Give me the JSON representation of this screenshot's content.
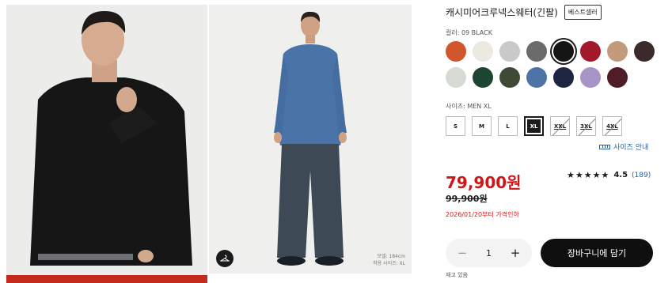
{
  "product": {
    "title": "캐시미어크루넥스웨터(긴팔)",
    "badge": "베스트셀러"
  },
  "images": {
    "model_info_line1": "모델: 184cm",
    "model_info_line2": "착용 사이즈: XL",
    "hanger_icon": "hanger-icon"
  },
  "color": {
    "label": "컬러: 09 BLACK",
    "swatches": [
      {
        "name": "orange",
        "hex": "#d2562b"
      },
      {
        "name": "off-white",
        "hex": "#ece9e1"
      },
      {
        "name": "light-gray",
        "hex": "#c9c9c9"
      },
      {
        "name": "dark-gray",
        "hex": "#6b6b6b"
      },
      {
        "name": "black",
        "hex": "#151515",
        "selected": true
      },
      {
        "name": "red",
        "hex": "#a3192b"
      },
      {
        "name": "camel",
        "hex": "#c39a7c"
      },
      {
        "name": "dark-brown",
        "hex": "#3b2a2a"
      },
      {
        "name": "light-green",
        "hex": "#d6dbd3"
      },
      {
        "name": "dark-green",
        "hex": "#1e4532"
      },
      {
        "name": "olive",
        "hex": "#3f4a36"
      },
      {
        "name": "blue",
        "hex": "#4e73a7"
      },
      {
        "name": "navy",
        "hex": "#1e2540"
      },
      {
        "name": "lavender",
        "hex": "#a795c6"
      },
      {
        "name": "wine",
        "hex": "#4f1c27"
      }
    ]
  },
  "size": {
    "label": "사이즈: MEN XL",
    "options": [
      {
        "label": "S",
        "state": "available"
      },
      {
        "label": "M",
        "state": "available"
      },
      {
        "label": "L",
        "state": "available"
      },
      {
        "label": "XL",
        "state": "selected"
      },
      {
        "label": "XXL",
        "state": "disabled"
      },
      {
        "label": "3XL",
        "state": "disabled"
      },
      {
        "label": "4XL",
        "state": "disabled"
      }
    ],
    "guide_label": "사이즈 안내",
    "guide_icon": "ruler-icon"
  },
  "pricing": {
    "price": "79,900원",
    "original_price": "99,900원",
    "sale_note": "2026/01/20부터 가격인하",
    "accent": "#d01616"
  },
  "rating": {
    "stars": "★★★★★",
    "value": "4.5",
    "count": "(189)",
    "score": 4.5
  },
  "purchase": {
    "qty_minus": "−",
    "qty_value": "1",
    "qty_plus": "+",
    "cart_label": "장바구니에 담기",
    "stock": "재고 있음"
  }
}
